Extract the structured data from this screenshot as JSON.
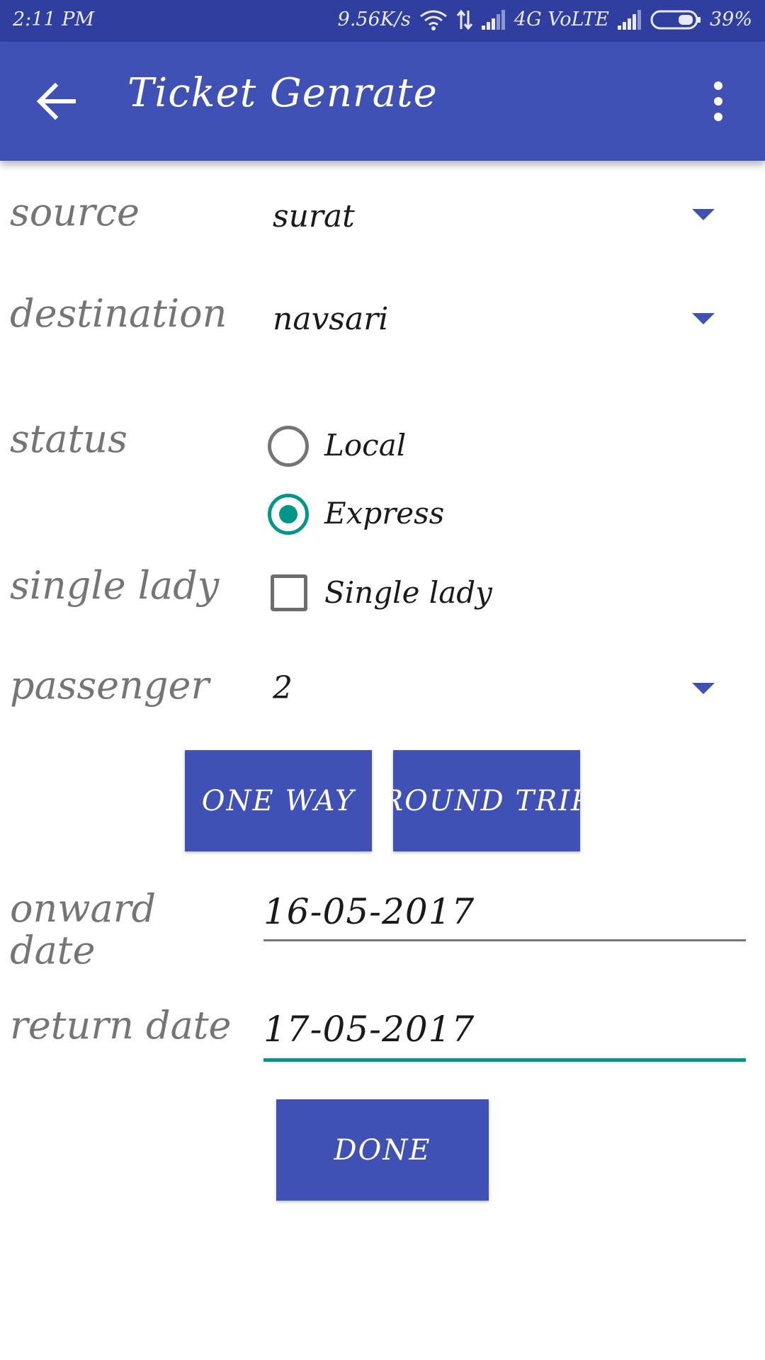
{
  "status_bar": {
    "time": "2:11 PM",
    "network_speed": "9.56K/s",
    "network_type": "4G VoLTE",
    "battery": "39%",
    "icons": [
      "wifi-icon",
      "data-transfer-icon",
      "signal-icon",
      "signal-icon",
      "battery-icon"
    ]
  },
  "toolbar": {
    "title": "Ticket Genrate",
    "back_icon": "arrow-back-icon",
    "menu_icon": "more-vert-icon",
    "color": "#3f51b5"
  },
  "form": {
    "source": {
      "label": "source",
      "value": "surat"
    },
    "destination": {
      "label": "destination",
      "value": "navsari"
    },
    "status": {
      "label": "status",
      "options": [
        {
          "label": "Local",
          "selected": false
        },
        {
          "label": "Express",
          "selected": true
        }
      ]
    },
    "single_lady": {
      "label": "single lady",
      "checkbox_label": "Single lady",
      "checked": false
    },
    "passenger": {
      "label": "passenger",
      "value": "2"
    },
    "trip_buttons": {
      "one_way": "ONE WAY",
      "round_trip": "ROUND TRIP"
    },
    "onward_date": {
      "label": "onward date",
      "value": "16-05-2017"
    },
    "return_date": {
      "label": "return date",
      "value": "17-05-2017",
      "focused": true
    },
    "done_button": "DONE"
  },
  "colors": {
    "primary": "#3f51b5",
    "primary_dark": "#303f9f",
    "accent": "#009688",
    "label_gray": "#757575"
  }
}
